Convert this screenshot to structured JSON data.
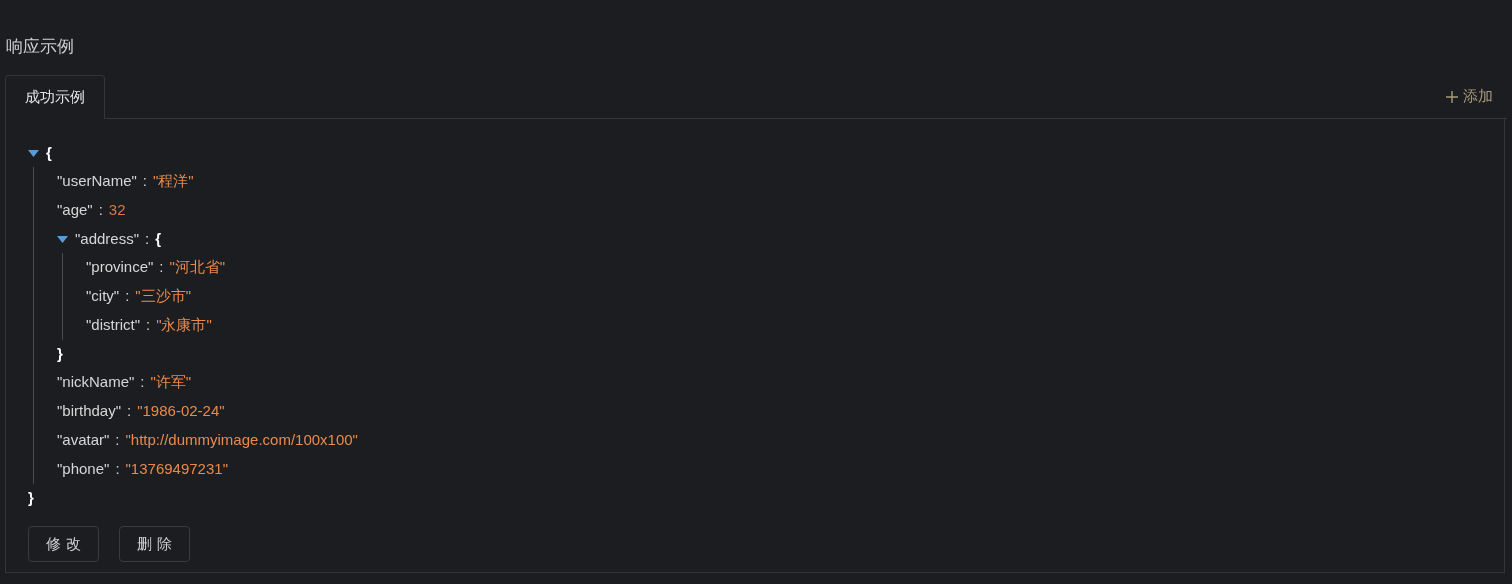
{
  "section_title": "响应示例",
  "tabs": [
    {
      "label": "成功示例",
      "selected": true
    }
  ],
  "add_button": {
    "label": "添加"
  },
  "separator": ":",
  "tree": {
    "kind": "object",
    "open": "{",
    "close": "}",
    "expanded": true,
    "children": [
      {
        "kind": "string",
        "key": "\"userName\"",
        "value": "\"程洋\""
      },
      {
        "kind": "number",
        "key": "\"age\"",
        "value": "32"
      },
      {
        "kind": "object",
        "key": "\"address\"",
        "open": "{",
        "close": "}",
        "expanded": true,
        "children": [
          {
            "kind": "string",
            "key": "\"province\"",
            "value": "\"河北省\""
          },
          {
            "kind": "string",
            "key": "\"city\"",
            "value": "\"三沙市\""
          },
          {
            "kind": "string",
            "key": "\"district\"",
            "value": "\"永康市\""
          }
        ]
      },
      {
        "kind": "string",
        "key": "\"nickName\"",
        "value": "\"许军\""
      },
      {
        "kind": "string",
        "key": "\"birthday\"",
        "value": "\"1986-02-24\""
      },
      {
        "kind": "string",
        "key": "\"avatar\"",
        "value": "\"http://dummyimage.com/100x100\""
      },
      {
        "kind": "string",
        "key": "\"phone\"",
        "value": "\"13769497231\""
      }
    ]
  },
  "buttons": [
    "修 改",
    "删 除"
  ]
}
